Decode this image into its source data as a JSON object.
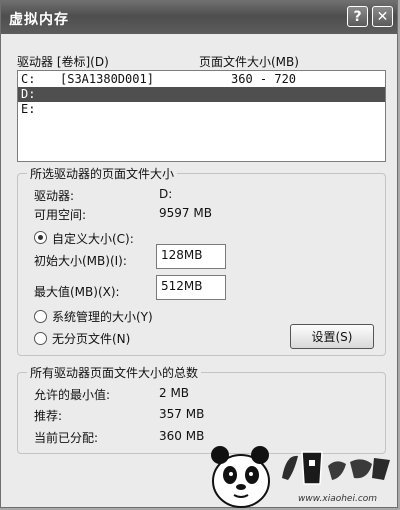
{
  "window": {
    "title": "虚拟内存",
    "help_label": "?",
    "close_label": "✕"
  },
  "list": {
    "header_drive": "驱动器 [卷标](D)",
    "header_size": "页面文件大小(MB)",
    "rows": [
      {
        "drive": "C:",
        "label": "[S3A1380D001]",
        "size": "360 - 720",
        "selected": false
      },
      {
        "drive": "D:",
        "label": "",
        "size": "",
        "selected": true
      },
      {
        "drive": "E:",
        "label": "",
        "size": "",
        "selected": false
      }
    ]
  },
  "selected_group": {
    "title": "所选驱动器的页面文件大小",
    "drive_label": "驱动器:",
    "drive_value": "D:",
    "space_label": "可用空间:",
    "space_value": "9597 MB",
    "custom_label": "自定义大小(C):",
    "initial_label": "初始大小(MB)(I):",
    "initial_value": "128MB",
    "max_label": "最大值(MB)(X):",
    "max_value": "512MB",
    "system_label": "系统管理的大小(Y)",
    "nopage_label": "无分页文件(N)",
    "set_button": "设置(S)"
  },
  "total_group": {
    "title": "所有驱动器页面文件大小的总数",
    "min_label": "允许的最小值:",
    "min_value": "2 MB",
    "rec_label": "推荐:",
    "rec_value": "357 MB",
    "cur_label": "当前已分配:",
    "cur_value": "360 MB"
  },
  "watermark": {
    "url": "www.xiaohei.com"
  }
}
